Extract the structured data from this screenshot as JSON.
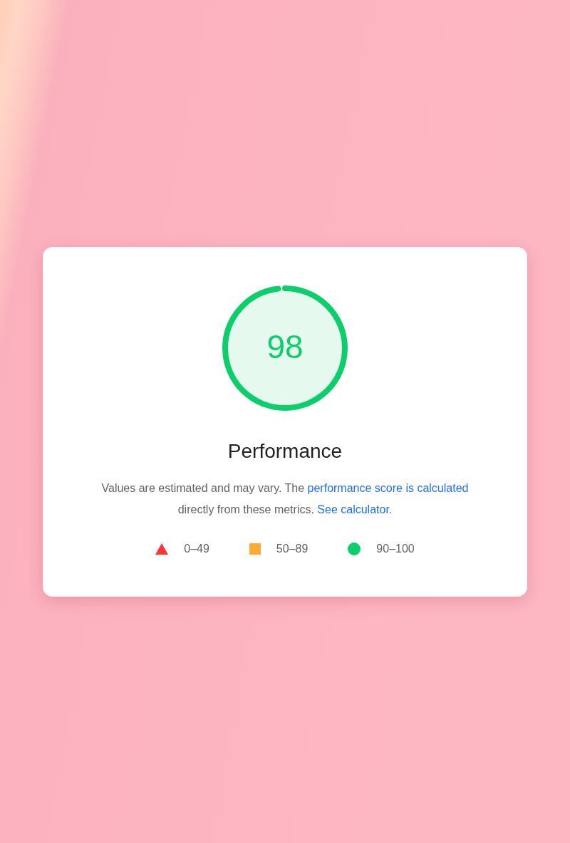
{
  "gauge": {
    "score": "98",
    "level": 0.98
  },
  "title": "Performance",
  "description": [
    {
      "kind": "text",
      "text": "Values are estimated and may vary. The "
    },
    {
      "kind": "link",
      "text": "performance score is calculated"
    },
    {
      "kind": "text",
      "text": " directly from these metrics. "
    },
    {
      "kind": "link",
      "text": "See calculator."
    }
  ],
  "legend": [
    {
      "kind": "triangle",
      "color": "#ff3333",
      "label": "0–49"
    },
    {
      "kind": "square",
      "color": "#ffaa33",
      "label": "50–89"
    },
    {
      "kind": "circle",
      "color": "#0cce6b",
      "label": "90–100"
    }
  ]
}
